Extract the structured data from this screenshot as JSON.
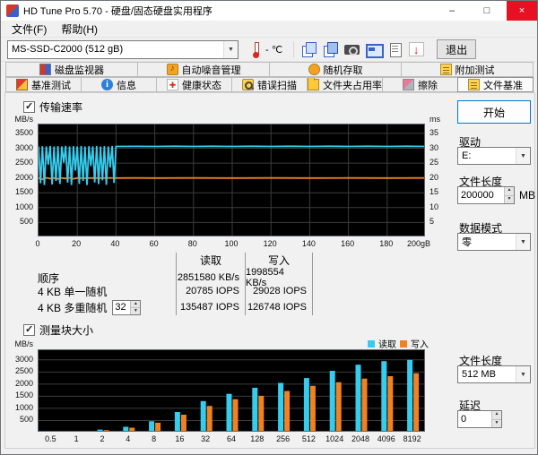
{
  "window": {
    "title": "HD Tune Pro 5.70 - 硬盘/固态硬盘实用程序",
    "buttons": {
      "minimize": "–",
      "maximize": "□",
      "close": "×"
    }
  },
  "menu": {
    "items": [
      {
        "label": "文件(F)"
      },
      {
        "label": "帮助(H)"
      }
    ]
  },
  "toolbar": {
    "drive_combo": "MS-SSD-C2000 (512 gB)",
    "temperature": "- ℃",
    "exit_label": "退出",
    "icons": [
      "copy-image-icon",
      "copy-text-icon",
      "camera-icon",
      "screenshot-icon",
      "document-icon",
      "download-arrow-icon"
    ]
  },
  "tabs": {
    "row1": [
      {
        "label": "磁盘监视器",
        "icon": "disk-monitor-icon"
      },
      {
        "label": "自动噪音管理",
        "icon": "aam-speaker-icon"
      },
      {
        "label": "随机存取",
        "icon": "random-access-icon"
      },
      {
        "label": "附加测试",
        "icon": "extra-tests-icon"
      }
    ],
    "row2": [
      {
        "label": "基准测试",
        "icon": "benchmark-icon"
      },
      {
        "label": "信息",
        "icon": "info-icon"
      },
      {
        "label": "健康状态",
        "icon": "health-icon"
      },
      {
        "label": "错误扫描",
        "icon": "error-scan-icon"
      },
      {
        "label": "文件夹占用率",
        "icon": "folder-usage-icon"
      },
      {
        "label": "擦除",
        "icon": "erase-icon"
      },
      {
        "label": "文件基准",
        "icon": "file-benchmark-icon",
        "active": true
      }
    ]
  },
  "filebench": {
    "transfer_checkbox": "传输速率",
    "block_checkbox": "测量块大小",
    "table": {
      "col_read": "读取",
      "col_write": "写入",
      "rows": [
        {
          "label": "顺序",
          "read": "2851580 KB/s",
          "write": "1998554 KB/s"
        },
        {
          "label": "4 KB 单一随机",
          "read": "20785 IOPS",
          "write": "29028 IOPS"
        },
        {
          "label": "4 KB 多重随机",
          "spin_value": "32",
          "read": "135487 IOPS",
          "write": "126748 IOPS"
        }
      ]
    },
    "legend": {
      "read": "读取",
      "write": "写入"
    }
  },
  "sidebar": {
    "start_button": "开始",
    "drive_label": "驱动",
    "drive_value": "E:",
    "filelen_label": "文件长度",
    "filelen_value": "200000",
    "filelen_unit": "MB",
    "datamode_label": "数据模式",
    "datamode_value": "零",
    "blocklen_label": "文件长度",
    "blocklen_value": "512 MB",
    "delay_label": "延迟",
    "delay_value": "0"
  },
  "colors": {
    "read": "#35cdee",
    "write": "#f08221",
    "grid": "#3c3c3c",
    "chart_bg": "#000000",
    "accent": "#0078d7",
    "close_red": "#e81123"
  },
  "chart_data": [
    {
      "type": "line",
      "name": "transfer-rate",
      "title": "传输速率",
      "ylabel": "MB/s",
      "ylabel_right": "ms",
      "ylim": [
        0,
        3800
      ],
      "yticks": [
        500,
        1000,
        1500,
        2000,
        2500,
        3000,
        3500
      ],
      "right_ticks": [
        5,
        10,
        15,
        20,
        25,
        30,
        35
      ],
      "right_scale": 100,
      "xlim": [
        0,
        200
      ],
      "xtick_labels": [
        "0",
        "20",
        "40",
        "60",
        "80",
        "100",
        "120",
        "140",
        "160",
        "180",
        "200gB"
      ],
      "legend_position": "none",
      "grid": true,
      "series": [
        {
          "name": "读取",
          "color_key": "read",
          "points": [
            [
              0,
              3060
            ],
            [
              1,
              1820
            ],
            [
              2,
              3070
            ],
            [
              3,
              1760
            ],
            [
              4,
              3060
            ],
            [
              5,
              2450
            ],
            [
              6,
              3080
            ],
            [
              7,
              1780
            ],
            [
              8,
              3060
            ],
            [
              9,
              1900
            ],
            [
              10,
              3070
            ],
            [
              11,
              1800
            ],
            [
              12,
              3060
            ],
            [
              13,
              2520
            ],
            [
              14,
              3080
            ],
            [
              15,
              1840
            ],
            [
              16,
              3060
            ],
            [
              17,
              1760
            ],
            [
              18,
              3070
            ],
            [
              19,
              2250
            ],
            [
              20,
              3060
            ],
            [
              21,
              1800
            ],
            [
              22,
              3080
            ],
            [
              23,
              1900
            ],
            [
              24,
              3060
            ],
            [
              25,
              1760
            ],
            [
              26,
              3070
            ],
            [
              27,
              2400
            ],
            [
              28,
              3060
            ],
            [
              29,
              1850
            ],
            [
              30,
              3080
            ],
            [
              31,
              1790
            ],
            [
              32,
              3060
            ],
            [
              33,
              1920
            ],
            [
              34,
              3070
            ],
            [
              35,
              1770
            ],
            [
              36,
              3060
            ],
            [
              37,
              2350
            ],
            [
              38,
              3080
            ],
            [
              39,
              1830
            ],
            [
              40,
              3060
            ],
            [
              50,
              3065
            ],
            [
              60,
              3060
            ],
            [
              70,
              3068
            ],
            [
              80,
              3060
            ],
            [
              90,
              3066
            ],
            [
              100,
              3060
            ],
            [
              110,
              3067
            ],
            [
              120,
              3060
            ],
            [
              130,
              3066
            ],
            [
              140,
              3060
            ],
            [
              150,
              3067
            ],
            [
              160,
              3060
            ],
            [
              170,
              3066
            ],
            [
              180,
              3060
            ],
            [
              190,
              3066
            ],
            [
              200,
              3062
            ]
          ]
        },
        {
          "name": "写入",
          "color_key": "write",
          "points": [
            [
              0,
              1995
            ],
            [
              2,
              1950
            ],
            [
              4,
              2005
            ],
            [
              6,
              1975
            ],
            [
              8,
              2000
            ],
            [
              10,
              1965
            ],
            [
              12,
              2000
            ],
            [
              14,
              1980
            ],
            [
              16,
              2005
            ],
            [
              18,
              1970
            ],
            [
              20,
              2000
            ],
            [
              24,
              1990
            ],
            [
              28,
              2000
            ],
            [
              32,
              1992
            ],
            [
              36,
              2000
            ],
            [
              40,
              1996
            ],
            [
              50,
              2000
            ],
            [
              60,
              1997
            ],
            [
              80,
              2000
            ],
            [
              100,
              1997
            ],
            [
              120,
              2000
            ],
            [
              140,
              1998
            ],
            [
              160,
              2000
            ],
            [
              180,
              1998
            ],
            [
              200,
              2000
            ]
          ]
        }
      ]
    },
    {
      "type": "bar",
      "name": "block-size",
      "title": "测量块大小",
      "ylabel": "MB/s",
      "ylim": [
        0,
        3400
      ],
      "yticks": [
        500,
        1000,
        1500,
        2000,
        2500,
        3000
      ],
      "categories": [
        "0.5",
        "1",
        "2",
        "4",
        "8",
        "16",
        "32",
        "64",
        "128",
        "256",
        "512",
        "1024",
        "2048",
        "4096",
        "8192"
      ],
      "legend_position": "top-right",
      "grid": true,
      "series": [
        {
          "name": "读取",
          "color_key": "read",
          "values": [
            30,
            60,
            125,
            240,
            470,
            850,
            1300,
            1600,
            1850,
            2050,
            2250,
            2550,
            2800,
            2950,
            3000
          ]
        },
        {
          "name": "写入",
          "color_key": "write",
          "values": [
            25,
            50,
            105,
            205,
            410,
            740,
            1100,
            1380,
            1520,
            1720,
            1930,
            2080,
            2230,
            2330,
            2450
          ]
        }
      ]
    }
  ]
}
